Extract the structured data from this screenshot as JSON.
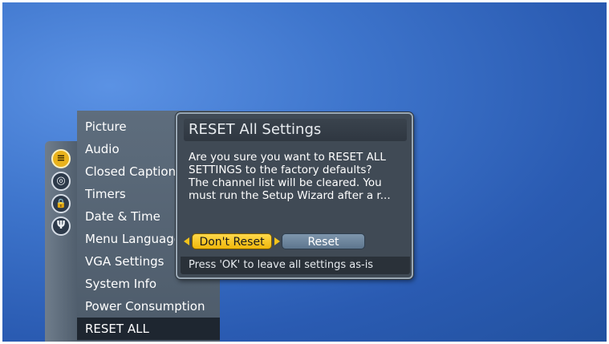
{
  "icon_rail": {
    "icons": [
      {
        "name": "settings-sliders-icon",
        "glyph": "≡",
        "active": true
      },
      {
        "name": "broadcast-signal-icon",
        "glyph": "◎",
        "active": false
      },
      {
        "name": "lock-icon",
        "glyph": "🔒",
        "active": false
      },
      {
        "name": "antenna-icon",
        "glyph": "Ψ",
        "active": false
      }
    ]
  },
  "menu": {
    "items": [
      "Picture",
      "Audio",
      "Closed Captions",
      "Timers",
      "Date & Time",
      "Menu Language",
      "VGA Settings",
      "System Info",
      "Power Consumption",
      "RESET ALL"
    ],
    "selected": "RESET ALL"
  },
  "dialog": {
    "title": "RESET All Settings",
    "message_1": "Are you sure you want to RESET ALL SETTINGS to the factory defaults?",
    "message_2": "The channel list will be cleared. You must run the Setup Wizard after a r...",
    "dont_reset_label": "Don't Reset",
    "reset_label": "Reset",
    "footer_hint": "Press 'OK' to leave all settings as-is"
  },
  "colors": {
    "background": "#3e75cc",
    "highlight": "#f0b80c",
    "panel": "#5e6d7d",
    "dialog": "#404a55"
  }
}
